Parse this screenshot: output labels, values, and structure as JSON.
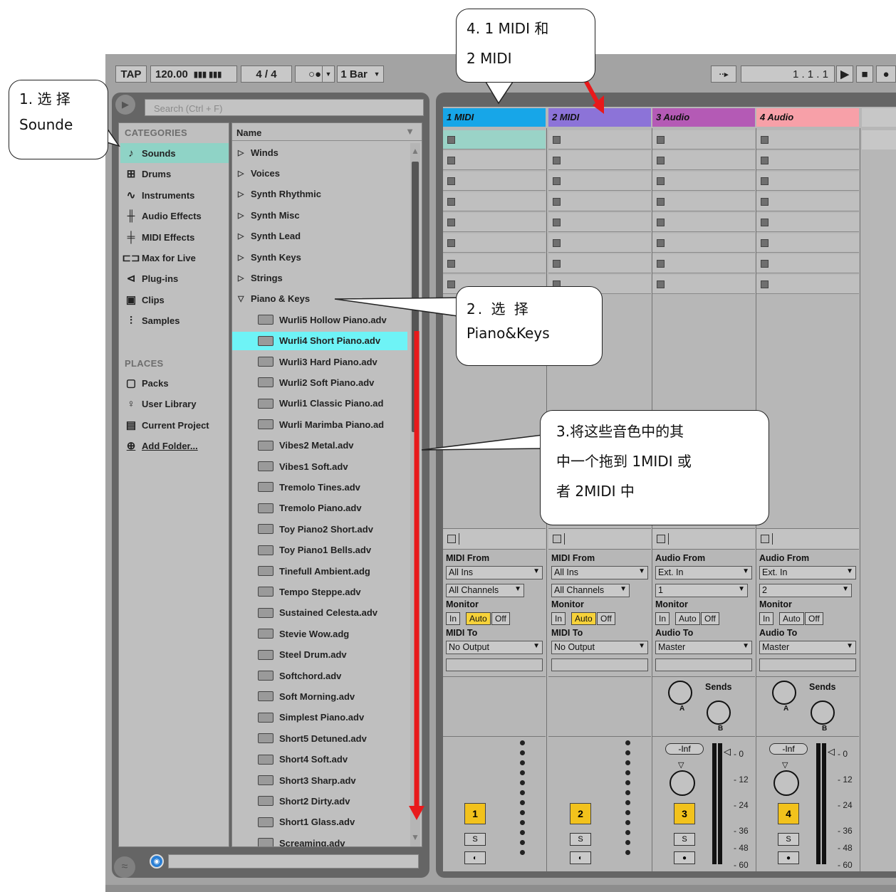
{
  "transport": {
    "tap": "TAP",
    "tempo": "120.00",
    "sig": "4 / 4",
    "quant": "1 Bar",
    "position": "1 .   1 .   1"
  },
  "browser": {
    "search_placeholder": "Search (Ctrl + F)",
    "categories_header": "CATEGORIES",
    "categories": [
      "Sounds",
      "Drums",
      "Instruments",
      "Audio Effects",
      "MIDI Effects",
      "Max for Live",
      "Plug-ins",
      "Clips",
      "Samples"
    ],
    "places_header": "PLACES",
    "places": [
      "Packs",
      "User Library",
      "Current Project",
      "Add Folder..."
    ],
    "name_header": "Name",
    "folders": [
      "Winds",
      "Voices",
      "Synth Rhythmic",
      "Synth Misc",
      "Synth Lead",
      "Synth Keys",
      "Strings",
      "Piano & Keys"
    ],
    "presets": [
      "Wurli5 Hollow Piano.adv",
      "Wurli4 Short Piano.adv",
      "Wurli3 Hard Piano.adv",
      "Wurli2 Soft Piano.adv",
      "Wurli1 Classic Piano.ad",
      "Wurli Marimba Piano.ad",
      "Vibes2 Metal.adv",
      "Vibes1 Soft.adv",
      "Tremolo Tines.adv",
      "Tremolo Piano.adv",
      "Toy Piano2 Short.adv",
      "Toy Piano1 Bells.adv",
      "Tinefull Ambient.adg",
      "Tempo Steppe.adv",
      "Sustained Celesta.adv",
      "Stevie Wow.adg",
      "Steel Drum.adv",
      "Softchord.adv",
      "Soft Morning.adv",
      "Simplest Piano.adv",
      "Short5 Detuned.adv",
      "Short4 Soft.adv",
      "Short3 Sharp.adv",
      "Short2 Dirty.adv",
      "Short1 Glass.adv",
      "Screaming.adv"
    ]
  },
  "tracks": [
    {
      "name": "1 MIDI",
      "color": "#17a6e8",
      "from_label": "MIDI From",
      "from": "All Ins",
      "ch": "All Channels",
      "monitor_label": "Monitor",
      "mon": [
        "In",
        "Auto",
        "Off"
      ],
      "to_label": "MIDI To",
      "to": "No Output",
      "num": "1",
      "solo": "S"
    },
    {
      "name": "2 MIDI",
      "color": "#8c73d8",
      "from_label": "MIDI From",
      "from": "All Ins",
      "ch": "All Channels",
      "monitor_label": "Monitor",
      "mon": [
        "In",
        "Auto",
        "Off"
      ],
      "to_label": "MIDI To",
      "to": "No Output",
      "num": "2",
      "solo": "S"
    },
    {
      "name": "3 Audio",
      "color": "#b45ab5",
      "from_label": "Audio From",
      "from": "Ext. In",
      "ch": "1",
      "monitor_label": "Monitor",
      "mon": [
        "In",
        "Auto",
        "Off"
      ],
      "to_label": "Audio To",
      "to": "Master",
      "num": "3",
      "solo": "S",
      "sends": "Sends",
      "vol": "-Inf"
    },
    {
      "name": "4 Audio",
      "color": "#f7a0a8",
      "from_label": "Audio From",
      "from": "Ext. In",
      "ch": "2",
      "monitor_label": "Monitor",
      "mon": [
        "In",
        "Auto",
        "Off"
      ],
      "to_label": "Audio To",
      "to": "Master",
      "num": "4",
      "solo": "S",
      "sends": "Sends",
      "vol": "-Inf"
    }
  ],
  "send_labels": [
    "A",
    "B"
  ],
  "db_scale": [
    "0",
    "12",
    "24",
    "36",
    "48",
    "60"
  ],
  "callouts": {
    "c1": "1. 选 择 Sounde",
    "c2a": "2.  选  择",
    "c2b": "Piano&Keys",
    "c3a": "3.将这些音色中的其",
    "c3b": "中一个拖到 1MIDI 或",
    "c3c": "者 2MIDI 中",
    "c4a": "4. 1 MIDI 和",
    "c4b": "2 MIDI"
  }
}
